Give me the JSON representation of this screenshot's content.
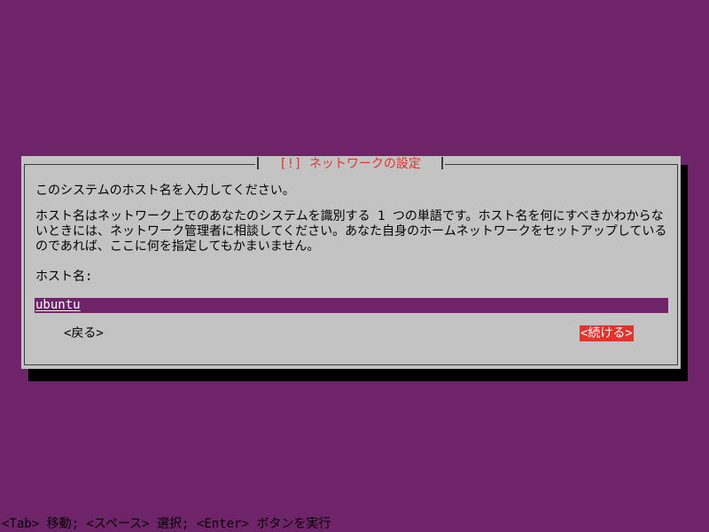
{
  "colors": {
    "background": "#6f2469",
    "dialog": "#c3c3c3",
    "title": "#e2332c",
    "active_button": "#e2332c"
  },
  "dialog": {
    "title": "[!] ネットワークの設定",
    "intro": "このシステムのホスト名を入力してください。",
    "description": "ホスト名はネットワーク上でのあなたのシステムを識別する 1 つの単語です。ホスト名を何にすべきかわからないときには、ネットワーク管理者に相談してください。あなた自身のホームネットワークをセットアップしているのであれば、ここに何を指定してもかまいません。",
    "hostname_label": "ホスト名:",
    "hostname_value": "ubuntu",
    "back_button": "<戻る>",
    "continue_button": "<続ける>"
  },
  "status_bar": {
    "text": "<Tab> 移動; <スペース> 選択; <Enter> ボタンを実行"
  }
}
